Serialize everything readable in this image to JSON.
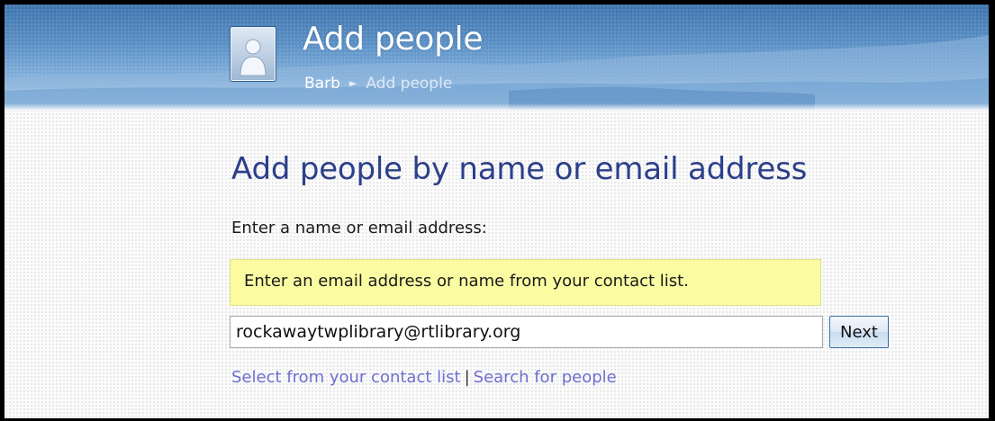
{
  "header": {
    "title": "Add people",
    "breadcrumb": {
      "parent": "Barb",
      "separator": "►",
      "current": "Add people"
    },
    "avatar_icon": "person-icon"
  },
  "main": {
    "heading": "Add people by name or email address",
    "field_label": "Enter a name or email address:",
    "hint": "Enter an email address or name from your contact list.",
    "input_value": "rockawaytwplibrary@rtlibrary.org",
    "next_label": "Next",
    "links": {
      "select_contacts": "Select from your contact list",
      "separator": "|",
      "search_people": "Search for people"
    }
  },
  "colors": {
    "heading": "#2c3f8a",
    "link": "#6f6fd0",
    "hint_background": "#fbfba2",
    "header_top": "#3f74ad"
  }
}
